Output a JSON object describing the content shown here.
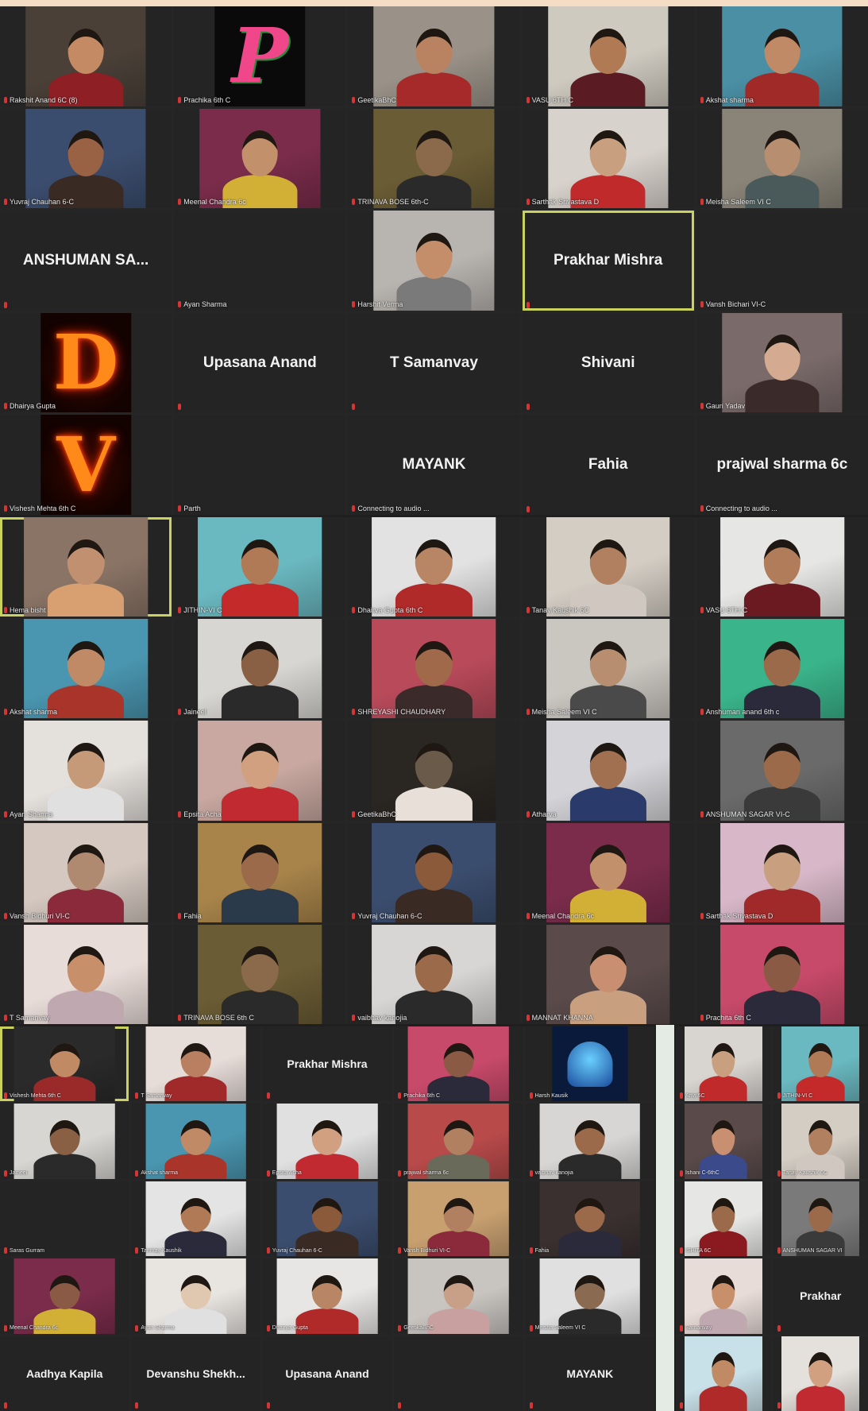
{
  "panels": [
    {
      "id": "panel-1",
      "cols": 5,
      "tiles": [
        {
          "label": "Rakshit Anand 6C (8)",
          "type": "video",
          "bg": "#4a4038",
          "shirt": "#8e1f24",
          "skin": "#c48a63"
        },
        {
          "label": "Prachika 6th C",
          "type": "avatar",
          "avatar_text": "P",
          "avatar_style": "pink-logo"
        },
        {
          "label": "GeetikaBhC",
          "type": "video",
          "bg": "#9a9288",
          "shirt": "#a72a2a",
          "skin": "#b98260"
        },
        {
          "label": "VASU 6TH C",
          "type": "video",
          "bg": "#cfcac0",
          "shirt": "#5a1c22",
          "skin": "#b07a55"
        },
        {
          "label": "Akshat sharma",
          "type": "video",
          "bg": "#4a8fa4",
          "shirt": "#a02a28",
          "skin": "#c08a66"
        },
        {
          "label": "Yuvraj Chauhan 6-C",
          "type": "video",
          "bg": "#3b4d6e",
          "shirt": "#3a2a24",
          "skin": "#9a6244"
        },
        {
          "label": "Meenal Chandra 6c",
          "type": "video",
          "bg": "#7a2c4a",
          "shirt": "#d2b035",
          "skin": "#c2906a"
        },
        {
          "label": "TRINAVA BOSE 6th-C",
          "type": "video",
          "bg": "#6a5c34",
          "shirt": "#2a2a2a",
          "skin": "#8a6a4a"
        },
        {
          "label": "Sarthak Srivastava D",
          "type": "video",
          "bg": "#d8d2cc",
          "shirt": "#c02a2a",
          "skin": "#c8a080"
        },
        {
          "label": "Meisha Saleem VI C",
          "type": "video",
          "bg": "#8a8478",
          "shirt": "#4a5a5a",
          "skin": "#b88e70"
        },
        {
          "label": "",
          "name": "ANSHUMAN SA...",
          "type": "name"
        },
        {
          "label": "Ayan Sharma",
          "name": "",
          "type": "name"
        },
        {
          "label": "Harshit Verma",
          "type": "video",
          "bg": "#b8b4b0",
          "shirt": "#7a7a7a",
          "skin": "#c48e6a"
        },
        {
          "label": "",
          "name": "Prakhar Mishra",
          "type": "name",
          "highlight": true
        },
        {
          "label": "Vansh Bichari VI-C",
          "name": "",
          "type": "name"
        },
        {
          "label": "Dhairya Gupta",
          "type": "avatar",
          "avatar_text": "D",
          "avatar_style": "fire"
        },
        {
          "label": "",
          "name": "Upasana Anand",
          "type": "name"
        },
        {
          "label": "",
          "name": "T Samanvay",
          "type": "name"
        },
        {
          "label": "",
          "name": "Shivani",
          "type": "name"
        },
        {
          "label": "Gauri Yadav",
          "type": "video",
          "bg": "#7a6a6a",
          "shirt": "#3a2a2a",
          "skin": "#d4aa90"
        },
        {
          "label": "Vishesh Mehta 6th C",
          "type": "avatar",
          "avatar_text": "V",
          "avatar_style": "fire"
        },
        {
          "label": "Parth",
          "name": "",
          "type": "name"
        },
        {
          "label": "Connecting to audio ...",
          "name": "MAYANK",
          "type": "name"
        },
        {
          "label": "",
          "name": "Fahia",
          "type": "name"
        },
        {
          "label": "Connecting to audio ...",
          "name": "prajwal sharma 6c",
          "type": "name"
        }
      ]
    },
    {
      "id": "panel-2",
      "cols": 5,
      "tiles": [
        {
          "label": "Hema bisht",
          "type": "video",
          "bg": "#8a7466",
          "shirt": "#d8a070",
          "skin": "#c09070",
          "highlight": true
        },
        {
          "label": "JITHIN-VI C",
          "type": "video",
          "bg": "#6ab8c0",
          "shirt": "#c42a2a",
          "skin": "#b07a56"
        },
        {
          "label": "Dhairya Gupta 6th C",
          "type": "video",
          "bg": "#e2e2e2",
          "shirt": "#b02a2a",
          "skin": "#b88664"
        },
        {
          "label": "Tanay Kaushik 6C",
          "type": "video",
          "bg": "#d4cdc4",
          "shirt": "#d0c8c0",
          "skin": "#b08060"
        },
        {
          "label": "VASU 6TH C",
          "type": "video",
          "bg": "#e6e6e4",
          "shirt": "#6a1a20",
          "skin": "#b07c5a"
        },
        {
          "label": "Akshat sharma",
          "type": "video",
          "bg": "#4a96b0",
          "shirt": "#a8342a",
          "skin": "#c08a66"
        },
        {
          "label": "Jaineel",
          "type": "video",
          "bg": "#d8d6d2",
          "shirt": "#2a2a2a",
          "skin": "#8a6044"
        },
        {
          "label": "SHREYASHI CHAUDHARY",
          "type": "video",
          "bg": "#b84a5a",
          "shirt": "#3a2a2a",
          "skin": "#a06a4a"
        },
        {
          "label": "Meisha Saleem VI C",
          "type": "video",
          "bg": "#cac6c0",
          "shirt": "#4a4a4a",
          "skin": "#b88e70"
        },
        {
          "label": "Anshuman anand 6th c",
          "type": "video",
          "bg": "#3ab48a",
          "shirt": "#2a2a3a",
          "skin": "#9a6a4a"
        },
        {
          "label": "Ayan Sharma",
          "type": "video",
          "bg": "#e4e0dc",
          "shirt": "#e0e0e0",
          "skin": "#c49a78"
        },
        {
          "label": "Epsita Acha",
          "type": "video",
          "bg": "#c8a8a0",
          "shirt": "#c02a30",
          "skin": "#d0a080"
        },
        {
          "label": "GeetikaBhC",
          "type": "video",
          "bg": "#2a2622",
          "shirt": "#e8e0d8",
          "skin": "#6a5a4a"
        },
        {
          "label": "Atharva",
          "type": "video",
          "bg": "#d4d4d8",
          "shirt": "#2a3a6a",
          "skin": "#a07050"
        },
        {
          "label": "ANSHUMAN SAGAR VI-C",
          "type": "video",
          "bg": "#6a6a6a",
          "shirt": "#3a3a3a",
          "skin": "#9a6a4a"
        },
        {
          "label": "Vansh Bidhuri VI-C",
          "type": "video",
          "bg": "#d4c8c0",
          "shirt": "#8a2a3a",
          "skin": "#b08a70"
        },
        {
          "label": "Fahia",
          "type": "video",
          "bg": "#a8844a",
          "shirt": "#2a3a4a",
          "skin": "#9a6a4a"
        },
        {
          "label": "Yuvraj Chauhan 6-C",
          "type": "video",
          "bg": "#3b4d6e",
          "shirt": "#3a2a24",
          "skin": "#8a5a3a"
        },
        {
          "label": "Meenal Chandra 6c",
          "type": "video",
          "bg": "#7a2c4a",
          "shirt": "#d2b035",
          "skin": "#c2906a"
        },
        {
          "label": "Sarthak Srivastava D",
          "type": "video",
          "bg": "#d8b8c8",
          "shirt": "#a02a2a",
          "skin": "#c8a080"
        },
        {
          "label": "T Samanvay",
          "type": "video",
          "bg": "#e8dcd8",
          "shirt": "#c0a8b0",
          "skin": "#c8906a"
        },
        {
          "label": "TRINAVA BOSE 6th C",
          "type": "video",
          "bg": "#6a5c34",
          "shirt": "#2a2a2a",
          "skin": "#8a6a4a"
        },
        {
          "label": "vaibhav kanojia",
          "type": "video",
          "bg": "#d8d6d4",
          "shirt": "#2a2a2a",
          "skin": "#9a6a4a"
        },
        {
          "label": "MANNAT KHANNA",
          "type": "video",
          "bg": "#5a4a4a",
          "shirt": "#c8a080",
          "skin": "#c89070"
        },
        {
          "label": "Prachita 6th C",
          "type": "video",
          "bg": "#c84a6a",
          "shirt": "#2a2a3a",
          "skin": "#8a5a44"
        }
      ]
    },
    {
      "id": "panel-3",
      "cols": 5,
      "tiles": [
        {
          "label": "Vishesh Mehta 6th C",
          "type": "video",
          "bg": "#2a2a2a",
          "shirt": "#9a2a2a",
          "skin": "#c08a64",
          "highlight": true
        },
        {
          "label": "T Samanvay",
          "type": "video",
          "bg": "#e6dcd8",
          "shirt": "#a02a2a",
          "skin": "#b88060"
        },
        {
          "label": "",
          "name": "Prakhar Mishra",
          "type": "name"
        },
        {
          "label": "Prachika 6th C",
          "type": "video",
          "bg": "#c84a6a",
          "shirt": "#2a2a3a",
          "skin": "#8a5a44"
        },
        {
          "label": "Harsh Kausik",
          "type": "avatar",
          "avatar_text": "",
          "avatar_style": "blue-logo"
        },
        {
          "label": "Jaineel",
          "type": "video",
          "bg": "#d8d6d2",
          "shirt": "#2a2a2a",
          "skin": "#8a6044"
        },
        {
          "label": "Akshat sharma",
          "type": "video",
          "bg": "#4a96b0",
          "shirt": "#a8342a",
          "skin": "#c08a66"
        },
        {
          "label": "Epsita Acha",
          "type": "video",
          "bg": "#e0e0e0",
          "shirt": "#c02a30",
          "skin": "#d0a080"
        },
        {
          "label": "prajwal sharma 6c",
          "type": "video",
          "bg": "#b84a4a",
          "shirt": "#6a6a5a",
          "skin": "#b08060"
        },
        {
          "label": "vaibhav kanojia",
          "type": "video",
          "bg": "#d8d6d4",
          "shirt": "#2a2a2a",
          "skin": "#9a6a4a"
        },
        {
          "label": "Saras Gurram",
          "name": "",
          "type": "name"
        },
        {
          "label": "Tanmay Kaushik",
          "type": "video",
          "bg": "#e4e4e4",
          "shirt": "#2a2a3a",
          "skin": "#b07a56"
        },
        {
          "label": "Yuvraj Chauhan 6-C",
          "type": "video",
          "bg": "#3b4d6e",
          "shirt": "#3a2a24",
          "skin": "#8a5a3a"
        },
        {
          "label": "Vansh Bidhuri VI-C",
          "type": "video",
          "bg": "#c8a070",
          "shirt": "#8a2a3a",
          "skin": "#b08060"
        },
        {
          "label": "Fahia",
          "type": "video",
          "bg": "#3a3030",
          "shirt": "#2a2a3a",
          "skin": "#9a6a4a"
        },
        {
          "label": "Meenal Chandra 6c",
          "type": "video",
          "bg": "#7a2c4a",
          "shirt": "#d2b035",
          "skin": "#8a5a44"
        },
        {
          "label": "Ayan Sharma",
          "type": "video",
          "bg": "#e8e4e0",
          "shirt": "#e0e0e0",
          "skin": "#e0c8b0"
        },
        {
          "label": "Dhairya Gupta",
          "type": "video",
          "bg": "#e8e6e4",
          "shirt": "#b02a2a",
          "skin": "#b88664"
        },
        {
          "label": "GeetikaBhC",
          "type": "video",
          "bg": "#c8c4c0",
          "shirt": "#c8a0a0",
          "skin": "#c8a088"
        },
        {
          "label": "Meisha Saleem VI C",
          "type": "video",
          "bg": "#e0e0e0",
          "shirt": "#2a2a2a",
          "skin": "#8a6a50"
        },
        {
          "label": "",
          "name": "Aadhya Kapila",
          "type": "name"
        },
        {
          "label": "",
          "name": "Devanshu Shekh...",
          "type": "name"
        },
        {
          "label": "",
          "name": "Upasana Anand",
          "type": "name"
        },
        {
          "label": "",
          "name": "",
          "type": "name"
        },
        {
          "label": "",
          "name": "MAYANK",
          "type": "name"
        }
      ]
    },
    {
      "id": "panel-4",
      "cols": 2,
      "tiles": [
        {
          "label": "Anvi 6C",
          "type": "video",
          "bg": "#d8d4d0",
          "shirt": "#c02a2a",
          "skin": "#c8a080"
        },
        {
          "label": "JITHIN-VI C",
          "type": "video",
          "bg": "#6ab8c0",
          "shirt": "#c42a2a",
          "skin": "#b07a56"
        },
        {
          "label": "Ishani C-6thC",
          "type": "video",
          "bg": "#5a4a4a",
          "shirt": "#3a4a8a",
          "skin": "#c89070"
        },
        {
          "label": "Tanay Kaushik 6C",
          "type": "video",
          "bg": "#d4cdc4",
          "shirt": "#d0c8c0",
          "skin": "#b08060"
        },
        {
          "label": "ISHITA 6C",
          "type": "video",
          "bg": "#e6e6e4",
          "shirt": "#8a1a20",
          "skin": "#9a6a4a"
        },
        {
          "label": "ANSHUMAN SAGAR VI",
          "type": "video",
          "bg": "#7a7a7a",
          "shirt": "#3a3a3a",
          "skin": "#9a6a4a"
        },
        {
          "label": "Samanvay",
          "type": "video",
          "bg": "#e8dcd8",
          "shirt": "#c0a8b0",
          "skin": "#c8906a"
        },
        {
          "label": "",
          "name": "Prakhar",
          "type": "name"
        },
        {
          "label": "",
          "type": "video",
          "bg": "#c8e0e8",
          "shirt": "#b02a2a",
          "skin": "#c08a64"
        },
        {
          "label": "",
          "type": "video",
          "bg": "#e4e0dc",
          "shirt": "#c02a30",
          "skin": "#d0a080"
        }
      ]
    }
  ]
}
